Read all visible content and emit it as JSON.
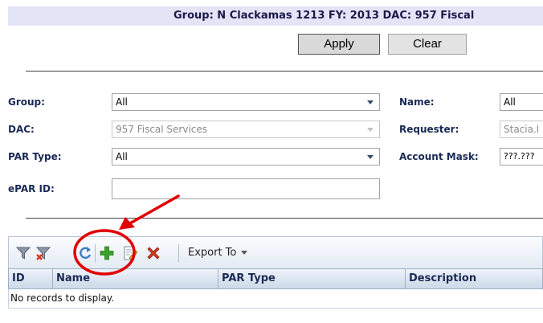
{
  "header": {
    "text": "Group: N Clackamas 1213   FY: 2013   DAC: 957 Fiscal"
  },
  "buttons": {
    "apply": "Apply",
    "clear": "Clear"
  },
  "filters": {
    "group": {
      "label": "Group:",
      "value": "All"
    },
    "dac": {
      "label": "DAC:",
      "value": "957 Fiscal Services"
    },
    "par_type": {
      "label": "PAR Type:",
      "value": "All"
    },
    "epar_id": {
      "label": "ePAR ID:",
      "value": ""
    },
    "name": {
      "label": "Name:",
      "value": "All"
    },
    "requester": {
      "label": "Requester:",
      "value": "Stacia.l"
    },
    "account_mask": {
      "label": "Account Mask:",
      "value": "???.???"
    }
  },
  "toolbar": {
    "icons": [
      "filter-icon",
      "clear-filter-icon",
      "refresh-icon",
      "add-icon",
      "edit-icon",
      "delete-icon"
    ],
    "export_label": "Export To"
  },
  "grid": {
    "columns": [
      "ID",
      "Name",
      "PAR Type",
      "Description"
    ],
    "empty_message": "No records to display."
  },
  "colors": {
    "header_band": "#e4e4f7",
    "label_text": "#1a2a55",
    "annotation": "#e00000",
    "add_icon": "#3aa12c",
    "delete_icon": "#d43a1c"
  }
}
